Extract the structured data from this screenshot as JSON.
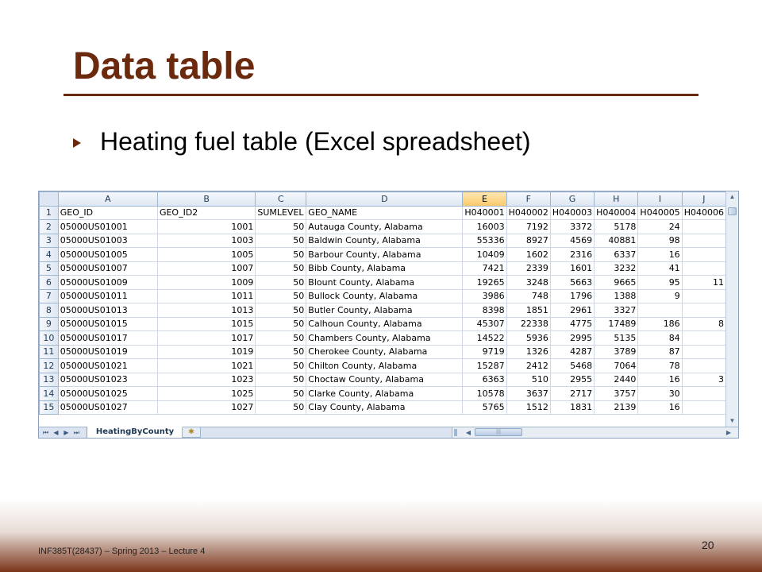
{
  "slide": {
    "title": "Data table",
    "bullet": "Heating fuel table (Excel spreadsheet)",
    "footer": "INF385T(28437) – Spring 2013 – Lecture 4",
    "page_number": "20"
  },
  "excel": {
    "selected_column": "E",
    "columns": [
      "A",
      "B",
      "C",
      "D",
      "E",
      "F",
      "G",
      "H",
      "I",
      "J"
    ],
    "rows": [
      {
        "n": "1",
        "cells": [
          "GEO_ID",
          "GEO_ID2",
          "SUMLEVEL",
          "GEO_NAME",
          "H040001",
          "H040002",
          "H040003",
          "H040004",
          "H040005",
          "H040006"
        ]
      },
      {
        "n": "2",
        "cells": [
          "05000US01001",
          "1001",
          "50",
          "Autauga County, Alabama",
          "16003",
          "7192",
          "3372",
          "5178",
          "24",
          ""
        ]
      },
      {
        "n": "3",
        "cells": [
          "05000US01003",
          "1003",
          "50",
          "Baldwin County, Alabama",
          "55336",
          "8927",
          "4569",
          "40881",
          "98",
          ""
        ]
      },
      {
        "n": "4",
        "cells": [
          "05000US01005",
          "1005",
          "50",
          "Barbour County, Alabama",
          "10409",
          "1602",
          "2316",
          "6337",
          "16",
          ""
        ]
      },
      {
        "n": "5",
        "cells": [
          "05000US01007",
          "1007",
          "50",
          "Bibb County, Alabama",
          "7421",
          "2339",
          "1601",
          "3232",
          "41",
          ""
        ]
      },
      {
        "n": "6",
        "cells": [
          "05000US01009",
          "1009",
          "50",
          "Blount County, Alabama",
          "19265",
          "3248",
          "5663",
          "9665",
          "95",
          "11"
        ]
      },
      {
        "n": "7",
        "cells": [
          "05000US01011",
          "1011",
          "50",
          "Bullock County, Alabama",
          "3986",
          "748",
          "1796",
          "1388",
          "9",
          ""
        ]
      },
      {
        "n": "8",
        "cells": [
          "05000US01013",
          "1013",
          "50",
          "Butler County, Alabama",
          "8398",
          "1851",
          "2961",
          "3327",
          "",
          ""
        ]
      },
      {
        "n": "9",
        "cells": [
          "05000US01015",
          "1015",
          "50",
          "Calhoun County, Alabama",
          "45307",
          "22338",
          "4775",
          "17489",
          "186",
          "8"
        ]
      },
      {
        "n": "10",
        "cells": [
          "05000US01017",
          "1017",
          "50",
          "Chambers County, Alabama",
          "14522",
          "5936",
          "2995",
          "5135",
          "84",
          ""
        ]
      },
      {
        "n": "11",
        "cells": [
          "05000US01019",
          "1019",
          "50",
          "Cherokee County, Alabama",
          "9719",
          "1326",
          "4287",
          "3789",
          "87",
          ""
        ]
      },
      {
        "n": "12",
        "cells": [
          "05000US01021",
          "1021",
          "50",
          "Chilton County, Alabama",
          "15287",
          "2412",
          "5468",
          "7064",
          "78",
          ""
        ]
      },
      {
        "n": "13",
        "cells": [
          "05000US01023",
          "1023",
          "50",
          "Choctaw County, Alabama",
          "6363",
          "510",
          "2955",
          "2440",
          "16",
          "3"
        ]
      },
      {
        "n": "14",
        "cells": [
          "05000US01025",
          "1025",
          "50",
          "Clarke County, Alabama",
          "10578",
          "3637",
          "2717",
          "3757",
          "30",
          ""
        ]
      },
      {
        "n": "15",
        "cells": [
          "05000US01027",
          "1027",
          "50",
          "Clay County, Alabama",
          "5765",
          "1512",
          "1831",
          "2139",
          "16",
          ""
        ]
      }
    ],
    "sheet_tab": "HeatingByCounty"
  },
  "icons": {
    "first_sheet": "⏮",
    "prev_sheet": "◀",
    "next_sheet": "▶",
    "last_sheet": "⏭",
    "new_sheet": "✱"
  },
  "colors": {
    "title": "#6b2a0d",
    "selected_header": "#f9c96a"
  }
}
